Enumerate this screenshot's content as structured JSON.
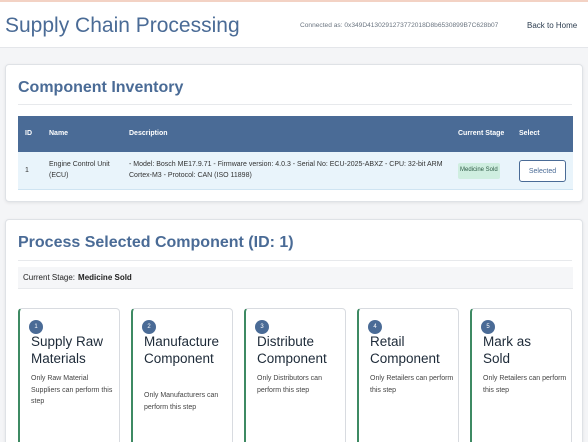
{
  "header": {
    "title": "Supply Chain Processing",
    "connected": "Connected as: 0x349D4130291273772018D8b6530899B7C628b07",
    "back_label": "Back to Home"
  },
  "inventory": {
    "title": "Component Inventory",
    "columns": [
      "ID",
      "Name",
      "Description",
      "Current Stage",
      "Select"
    ],
    "rows": [
      {
        "id": "1",
        "name": "Engine Control Unit (ECU)",
        "description": "- Model: Bosch ME17.9.71 - Firmware version: 4.0.3 - Serial No: ECU-2025-ABXZ - CPU: 32-bit ARM Cortex-M3 - Protocol: CAN (ISO 11898)",
        "stage": "Medicine Sold",
        "select_label": "Selected"
      }
    ]
  },
  "process": {
    "title": "Process Selected Component (ID: 1)",
    "current_stage_label": "Current Stage:",
    "current_stage_value": "Medicine Sold",
    "steps": [
      {
        "num": "1",
        "title": "Supply Raw Materials",
        "desc": "Only Raw Material Suppliers can perform this step"
      },
      {
        "num": "2",
        "title": "Manufacture Component",
        "desc": "Only Manufacturers can perform this step"
      },
      {
        "num": "3",
        "title": "Distribute Component",
        "desc": "Only Distributors can perform this step"
      },
      {
        "num": "4",
        "title": "Retail Component",
        "desc": "Only Retailers can perform this step"
      },
      {
        "num": "5",
        "title": "Mark as Sold",
        "desc": "Only Retailers can perform this step"
      }
    ]
  },
  "colors": {
    "primary": "#4a6b96",
    "stage_badge": "#cfeee0",
    "step_accent": "#3e8a63",
    "row_highlight": "#e9f4fb"
  }
}
